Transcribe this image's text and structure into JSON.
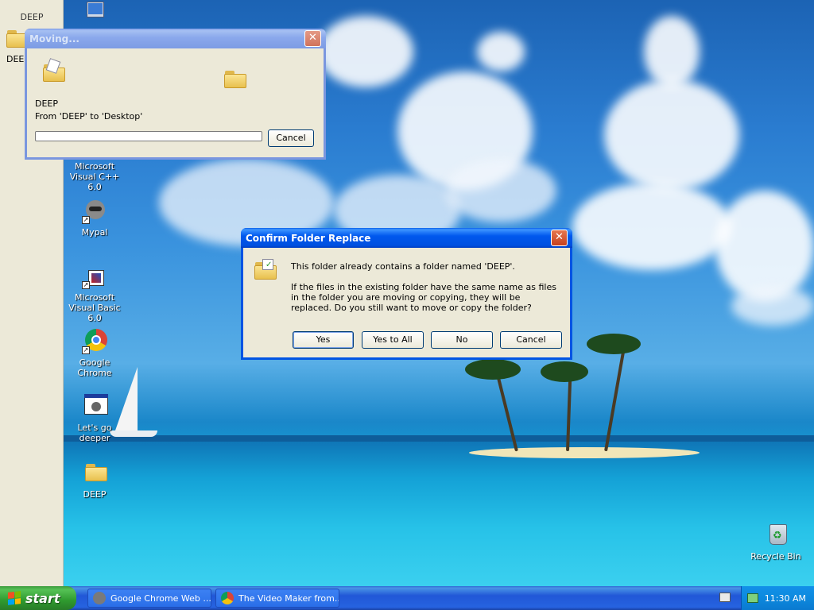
{
  "left_strip": {
    "title": "DEEP",
    "folder_label": "DEEP"
  },
  "desktop_icons": [
    {
      "label": "Microsoft Visual C++ 6.0",
      "icon": "vc-icon"
    },
    {
      "label": "Mypal",
      "icon": "raccoon-icon"
    },
    {
      "label": "Microsoft Visual Basic 6.0",
      "icon": "vb-icon"
    },
    {
      "label": "Google Chrome",
      "icon": "chrome-icon"
    },
    {
      "label": "Let's go deeper",
      "icon": "app-window-icon"
    },
    {
      "label": "DEEP",
      "icon": "folder-icon"
    },
    {
      "label": "Recycle Bin",
      "icon": "recycle-bin-icon"
    }
  ],
  "moving_dialog": {
    "title": "Moving...",
    "item_name": "DEEP",
    "from_to": "From 'DEEP' to 'Desktop'",
    "progress": 0,
    "cancel_label": "Cancel",
    "close_label": "✕"
  },
  "confirm_dialog": {
    "title": "Confirm Folder Replace",
    "close_label": "✕",
    "line1": "This folder already contains a folder named 'DEEP'.",
    "line2": "If the files in the existing folder have the same name as files in the folder you are moving or copying, they will be replaced.  Do you still want to move or copy the folder?",
    "buttons": {
      "yes": "Yes",
      "yes_to_all": "Yes to All",
      "no": "No",
      "cancel": "Cancel"
    }
  },
  "taskbar": {
    "start_label": "start",
    "tasks": [
      {
        "label": "Google Chrome Web ...",
        "icon": "raccoon-icon"
      },
      {
        "label": "The Video Maker from...",
        "icon": "chrome-icon"
      }
    ],
    "clock": "11:30 AM"
  },
  "colors": {
    "title_active": "#0054e3",
    "title_inactive": "#7a96df",
    "start_green": "#3c9a3c",
    "taskbar_blue": "#2157d7",
    "dialog_face": "#ece9d8"
  }
}
